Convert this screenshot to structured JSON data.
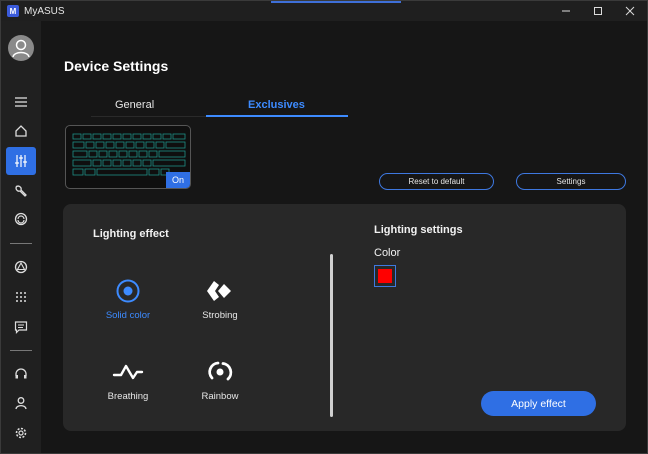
{
  "window": {
    "title": "MyASUS",
    "logo_text": "M"
  },
  "page": {
    "title": "Device Settings"
  },
  "tabs": [
    {
      "label": "General",
      "active": false
    },
    {
      "label": "Exclusives",
      "active": true
    }
  ],
  "keyboard": {
    "status": "On"
  },
  "buttons": {
    "reset": "Reset to default",
    "settings": "Settings",
    "apply": "Apply effect"
  },
  "lighting_effect": {
    "title": "Lighting effect",
    "items": [
      {
        "label": "Solid color",
        "icon": "solid-color-icon",
        "active": true
      },
      {
        "label": "Strobing",
        "icon": "strobing-icon",
        "active": false
      },
      {
        "label": "Breathing",
        "icon": "breathing-icon",
        "active": false
      },
      {
        "label": "Rainbow",
        "icon": "rainbow-icon",
        "active": false
      }
    ]
  },
  "lighting_settings": {
    "title": "Lighting settings",
    "color_label": "Color",
    "color_value": "#ff0000"
  },
  "colors": {
    "accent": "#2f6fe4",
    "accent_text": "#3d8bff"
  }
}
